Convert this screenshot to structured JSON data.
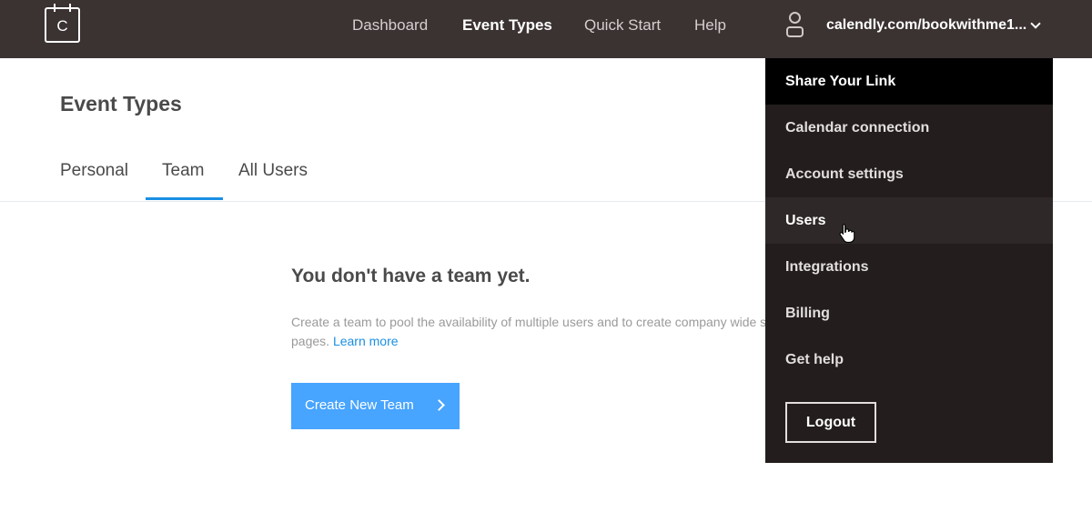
{
  "app": {
    "logo_letter": "C",
    "accent_color": "#1a8fe3",
    "button_color": "#47a4ff",
    "topbar_color": "#3b3232",
    "dropdown_color": "#231d1d"
  },
  "nav": {
    "items": [
      {
        "label": "Dashboard",
        "active": false
      },
      {
        "label": "Event Types",
        "active": true
      },
      {
        "label": "Quick Start",
        "active": false
      },
      {
        "label": "Help",
        "active": false
      }
    ],
    "account": {
      "icon": "user-icon",
      "url": "calendly.com/bookwithme1...",
      "caret_icon": "chevron-down-icon"
    }
  },
  "page": {
    "title": "Event Types",
    "tabs": [
      {
        "label": "Personal",
        "active": false
      },
      {
        "label": "Team",
        "active": true
      },
      {
        "label": "All Users",
        "active": false
      }
    ]
  },
  "empty_state": {
    "title": "You don't have a team yet.",
    "description": "Create a team to pool the availability of multiple users and to create company wide scheduling pages.",
    "learn_more": "Learn more",
    "button_label": "Create New Team",
    "button_icon": "chevron-right-icon"
  },
  "dropdown": {
    "items": [
      {
        "label": "Share Your Link",
        "state": "highlighted"
      },
      {
        "label": "Calendar connection",
        "state": "normal"
      },
      {
        "label": "Account settings",
        "state": "normal"
      },
      {
        "label": "Users",
        "state": "hover"
      },
      {
        "label": "Integrations",
        "state": "normal"
      },
      {
        "label": "Billing",
        "state": "normal"
      },
      {
        "label": "Get help",
        "state": "normal"
      }
    ],
    "logout_label": "Logout"
  }
}
